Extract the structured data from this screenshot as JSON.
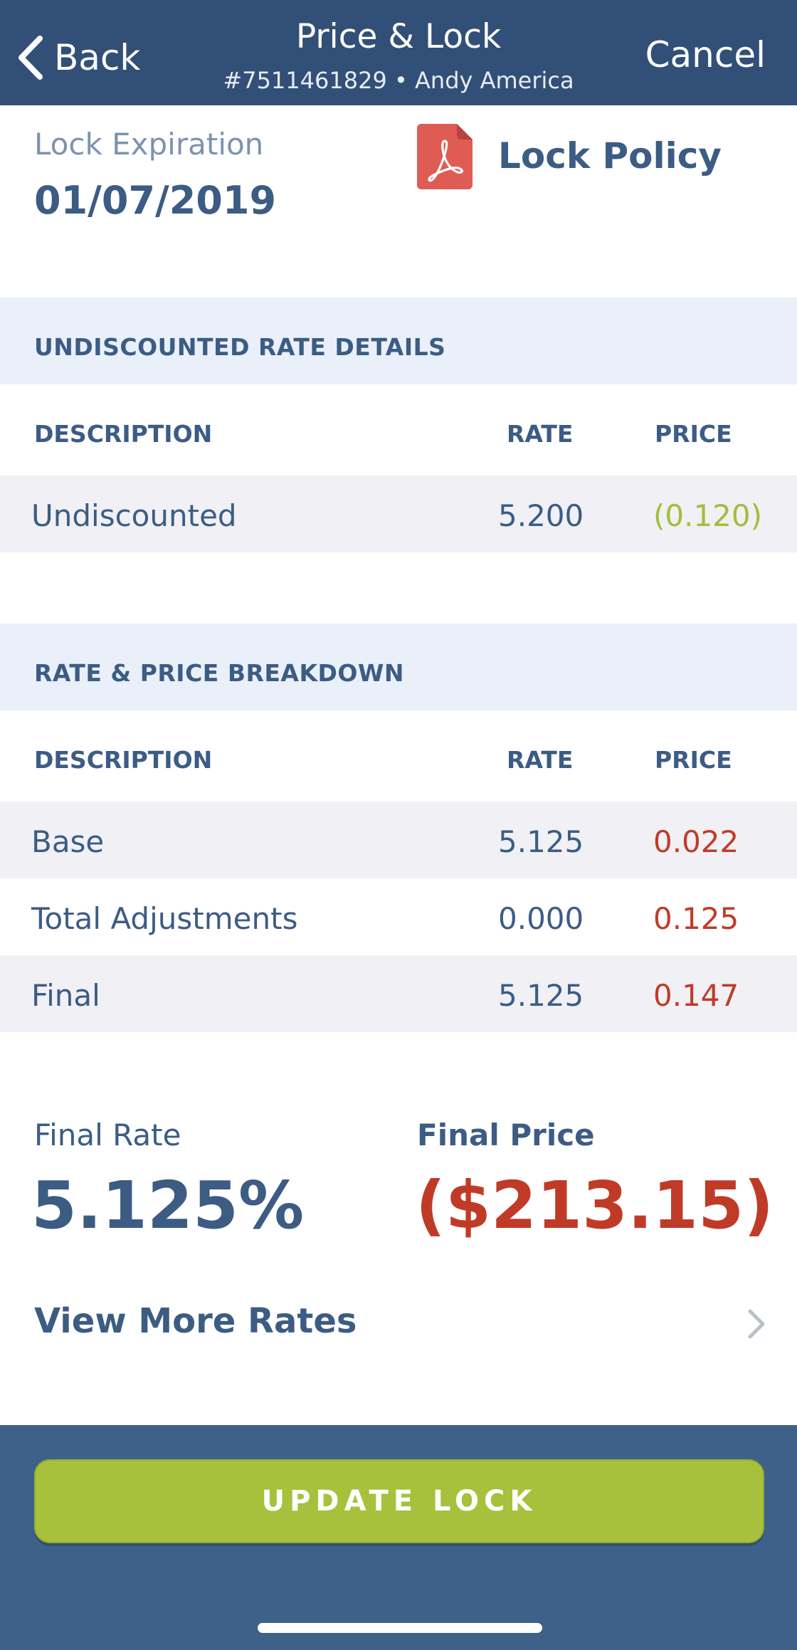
{
  "nav": {
    "back_label": "Back",
    "title": "Price & Lock",
    "subtitle": "#7511461829 • Andy America",
    "cancel_label": "Cancel"
  },
  "lock": {
    "expiration_label": "Lock Expiration",
    "expiration_value": "01/07/2019",
    "policy_label": "Lock Policy",
    "policy_icon": "pdf-file-icon"
  },
  "undiscounted": {
    "header": "UNDISCOUNTED RATE DETAILS",
    "columns": {
      "description": "DESCRIPTION",
      "rate": "RATE",
      "price": "PRICE"
    },
    "rows": [
      {
        "description": "Undiscounted",
        "rate": "5.200",
        "price": "(0.120)",
        "price_color": "#a3bd3a"
      }
    ]
  },
  "breakdown": {
    "header": "RATE & PRICE BREAKDOWN",
    "columns": {
      "description": "DESCRIPTION",
      "rate": "RATE",
      "price": "PRICE"
    },
    "rows": [
      {
        "description": "Base",
        "rate": "5.125",
        "price": "0.022",
        "price_color": "#c03b27"
      },
      {
        "description": "Total Adjustments",
        "rate": "0.000",
        "price": "0.125",
        "price_color": "#c03b27"
      },
      {
        "description": "Final",
        "rate": "5.125",
        "price": "0.147",
        "price_color": "#c03b27"
      }
    ]
  },
  "summary": {
    "final_rate_label": "Final Rate",
    "final_rate_value": "5.125%",
    "final_price_label": "Final Price",
    "final_price_value": "($213.15)"
  },
  "view_more": {
    "label": "View More Rates",
    "icon": "chevron-right-icon"
  },
  "footer": {
    "update_label": "UPDATE LOCK"
  },
  "colors": {
    "nav_bg": "#324f77",
    "primary_text": "#3c5c84",
    "accent_green": "#a7c13c",
    "negative_red": "#c03b27",
    "section_bg": "#e9f0f9"
  }
}
